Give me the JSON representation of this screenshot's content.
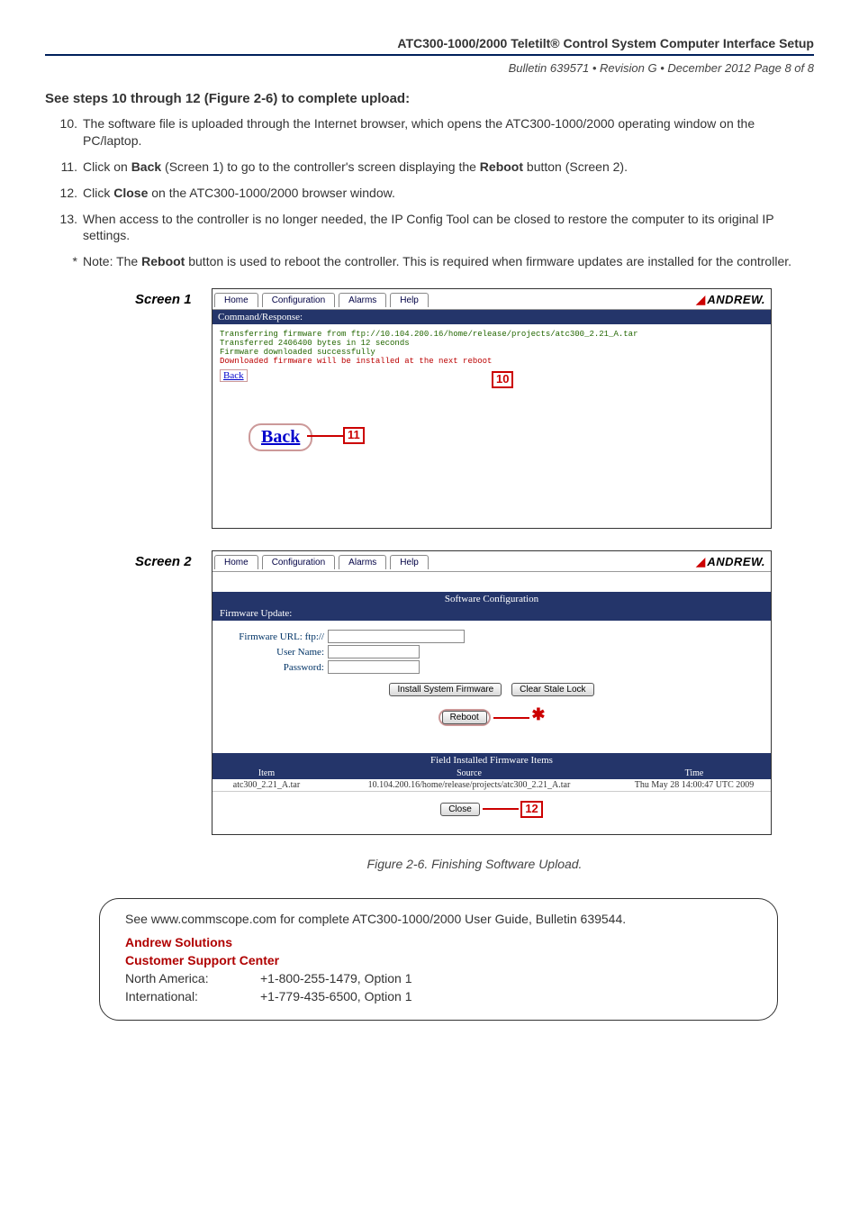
{
  "header": {
    "title": "ATC300-1000/2000 Teletilt® Control System Computer Interface Setup",
    "meta": "Bulletin 639571 • Revision G • December 2012 Page 8 of 8"
  },
  "section_heading": "See steps 10 through 12 (Figure 2-6) to complete upload:",
  "steps": {
    "s10_num": "10.",
    "s10_a": "The software file is uploaded through the Internet browser, which opens the ATC300-1000/2000 operating window on the PC/laptop.",
    "s11_num": "11.",
    "s11_a": "Click on ",
    "s11_back": "Back",
    "s11_b": " (Screen 1) to go to the controller's screen displaying the ",
    "s11_reboot": "Reboot",
    "s11_c": " button (Screen 2).",
    "s12_num": "12.",
    "s12_a": "Click ",
    "s12_close": "Close",
    "s12_b": " on the ATC300-1000/2000 browser window.",
    "s13_num": "13.",
    "s13_a": "When access to the controller is no longer needed, the IP Config Tool can be closed to restore the computer to its original IP settings."
  },
  "note": {
    "star": "*",
    "a": "Note: The ",
    "reboot": "Reboot",
    "b": " button is used to reboot the controller. This is required when firmware updates are installed for the controller."
  },
  "nav": {
    "home": "Home",
    "config": "Configuration",
    "alarms": "Alarms",
    "help": "Help",
    "logo": "ANDREW."
  },
  "screen1": {
    "label": "Screen 1",
    "cmd_resp": "Command/Response:",
    "l1": "Transferring firmware from ftp://10.104.200.16/home/release/projects/atc300_2.21_A.tar",
    "l2": "Transferred 2406400 bytes in 12 seconds",
    "l3": "Firmware downloaded successfully",
    "l4": "Downloaded firmware will be installed at the next reboot",
    "back_small": "Back",
    "back_big": "Back",
    "c10": "10",
    "c11": "11"
  },
  "screen2": {
    "label": "Screen 2",
    "sw_config": "Software Configuration",
    "fw_update": "Firmware Update:",
    "fw_url_lbl": "Firmware URL: ftp://",
    "user_lbl": "User Name:",
    "pass_lbl": "Password:",
    "install_btn": "Install System Firmware",
    "clear_btn": "Clear Stale Lock",
    "reboot_btn": "Reboot",
    "field_items": "Field Installed Firmware Items",
    "col_item": "Item",
    "col_source": "Source",
    "col_time": "Time",
    "row_item": "atc300_2.21_A.tar",
    "row_source": "10.104.200.16/home/release/projects/atc300_2.21_A.tar",
    "row_time": "Thu May 28 14:00:47 UTC 2009",
    "close_btn": "Close",
    "c12": "12"
  },
  "figure_caption": "Figure 2-6. Finishing Software Upload.",
  "footer": {
    "line1": "See www.commscope.com for complete ATC300-1000/2000 User Guide, Bulletin 639544.",
    "andrew": "Andrew Solutions",
    "csc": "Customer Support Center",
    "na_lbl": "North America:",
    "na_val": "+1-800-255-1479, Option 1",
    "intl_lbl": "International:",
    "intl_val": "+1-779-435-6500, Option 1"
  }
}
